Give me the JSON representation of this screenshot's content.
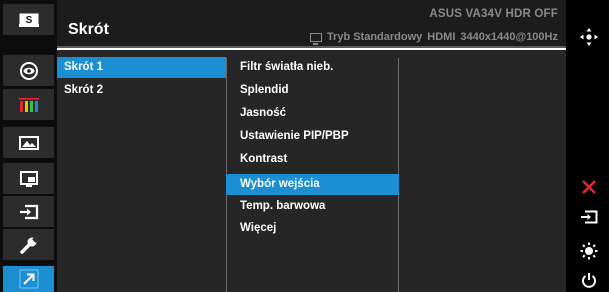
{
  "header": {
    "title": "Skrót",
    "model": "ASUS VA34V HDR OFF",
    "mode": "Tryb Standardowy",
    "input": "HDMI",
    "resolution": "3440x1440@100Hz"
  },
  "left_icons": [
    {
      "name": "splendid-s-icon",
      "glyph": "S"
    },
    {
      "name": "eye-care-icon"
    },
    {
      "name": "color-bars-icon"
    },
    {
      "name": "image-icon"
    },
    {
      "name": "pip-icon"
    },
    {
      "name": "input-select-icon"
    },
    {
      "name": "system-wrench-icon"
    },
    {
      "name": "shortcut-arrow-icon",
      "active": true
    }
  ],
  "submenu": [
    {
      "label": "Skrót 1",
      "selected": true
    },
    {
      "label": "Skrót 2",
      "selected": false
    }
  ],
  "options": [
    {
      "label": "Filtr światła nieb.",
      "selected": false
    },
    {
      "label": "Splendid",
      "selected": false
    },
    {
      "label": "Jasność",
      "selected": false
    },
    {
      "label": "Ustawienie PIP/PBP",
      "selected": false
    },
    {
      "label": "Kontrast",
      "selected": false
    },
    {
      "label": "Wybór wejścia",
      "selected": true
    },
    {
      "label": "Temp. barwowa",
      "selected": false
    },
    {
      "label": "Więcej",
      "selected": false
    }
  ],
  "right_controls": [
    "five-way-navigator-icon",
    "close-icon",
    "input-switch-icon",
    "brightness-icon",
    "power-icon"
  ],
  "colors": {
    "accent": "#1b8fd2",
    "close": "#e8252b",
    "panel": "#262626",
    "header": "#1c1c1c",
    "muted_text": "#8a8a8a"
  }
}
